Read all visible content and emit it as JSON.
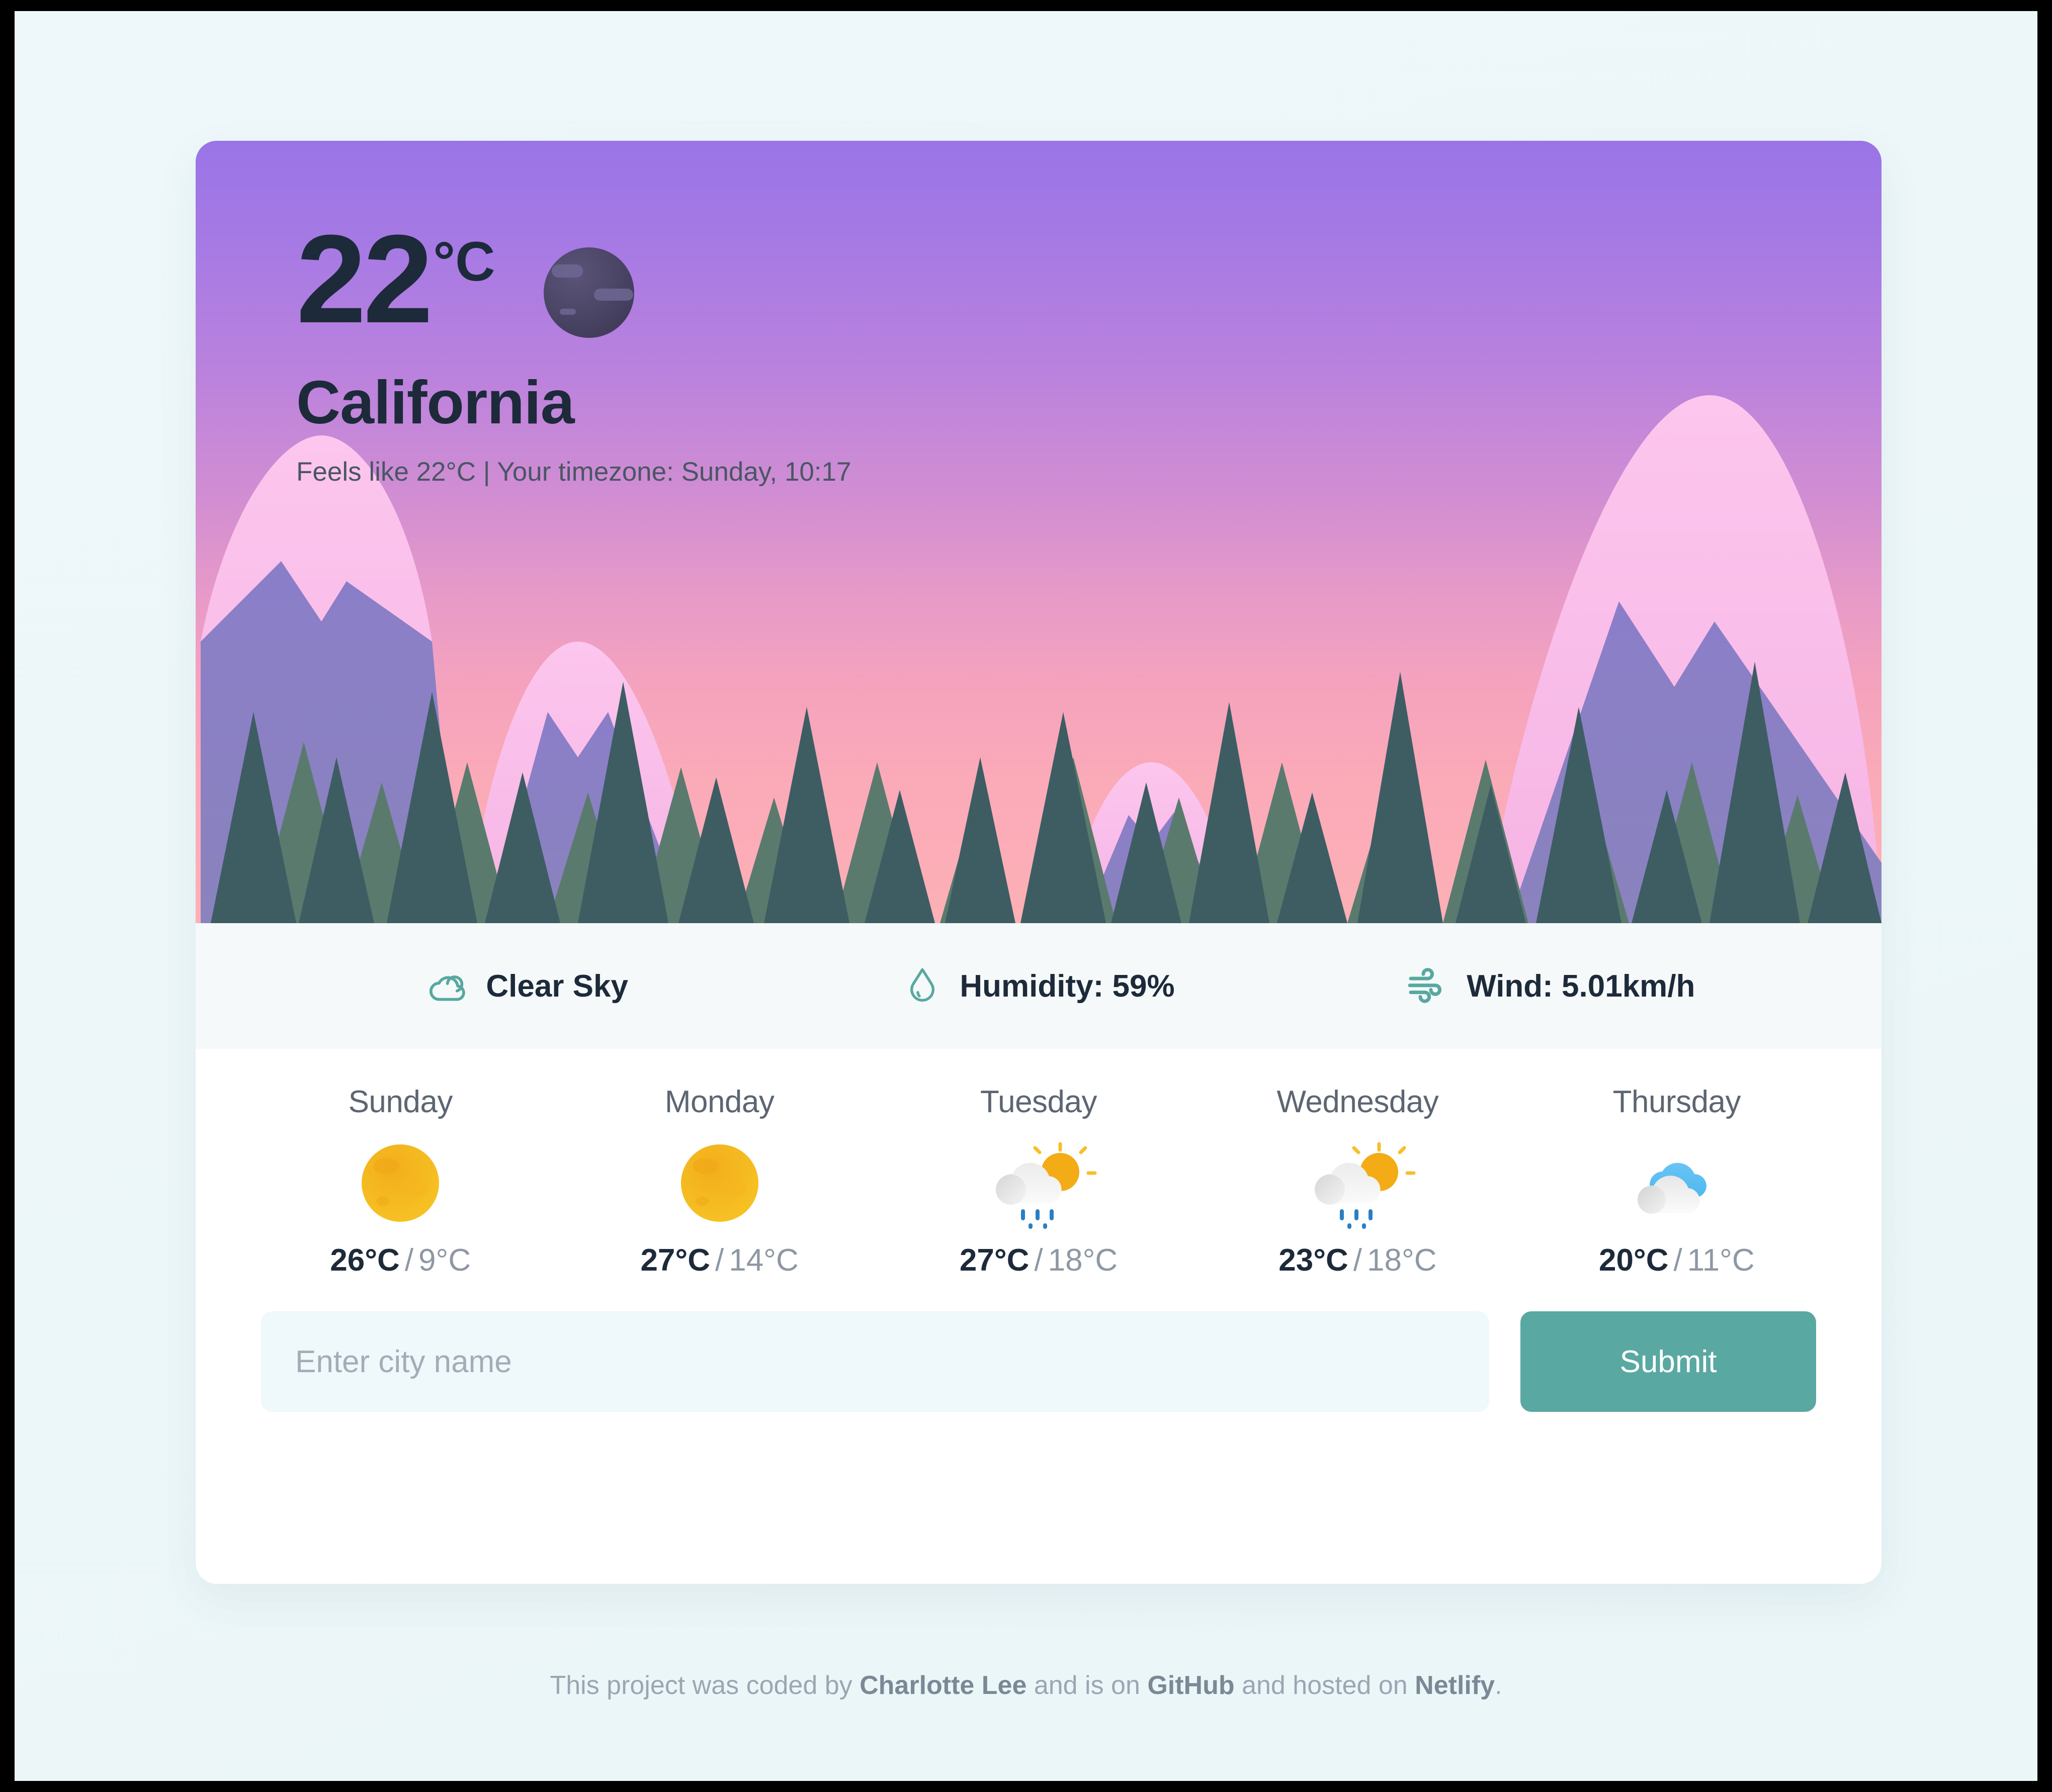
{
  "hero": {
    "temperature": "22",
    "unit": "°C",
    "icon": "moon-icon",
    "city": "California",
    "details": "Feels like 22°C | Your timezone: Sunday, 10:17"
  },
  "stats": [
    {
      "icon": "cloud-icon",
      "label": "Clear Sky"
    },
    {
      "icon": "droplet-icon",
      "label": "Humidity: 59%"
    },
    {
      "icon": "wind-icon",
      "label": "Wind: 5.01km/h"
    }
  ],
  "forecast": [
    {
      "day": "Sunday",
      "icon": "sun-icon",
      "max": "26°C",
      "sep": "/",
      "min": "9°C"
    },
    {
      "day": "Monday",
      "icon": "sun-icon",
      "max": "27°C",
      "sep": "/",
      "min": "14°C"
    },
    {
      "day": "Tuesday",
      "icon": "sun-cloud-rain-icon",
      "max": "27°C",
      "sep": "/",
      "min": "18°C"
    },
    {
      "day": "Wednesday",
      "icon": "sun-cloud-rain-icon",
      "max": "23°C",
      "sep": "/",
      "min": "18°C"
    },
    {
      "day": "Thursday",
      "icon": "clouds-icon",
      "max": "20°C",
      "sep": "/",
      "min": "11°C"
    }
  ],
  "search": {
    "placeholder": "Enter city name",
    "value": "",
    "submit_label": "Submit"
  },
  "footer": {
    "text_1": "This project was coded by ",
    "author": "Charlotte Lee",
    "text_2": " and is on ",
    "repo": "GitHub",
    "text_3": " and hosted on ",
    "host": "Netlify",
    "text_4": "."
  },
  "colors": {
    "accent_teal": "#5aa8a2",
    "hero_purple": "#9a74e6",
    "hero_pink": "#fdb0b6",
    "text_dark": "#1d2a3a",
    "text_muted": "#8e98a4",
    "page_bg": "#eef8fa",
    "stats_bg": "#f5f9fa",
    "input_bg": "#eff8fa",
    "mountain_snow": "#f9bce8",
    "mountain_body": "#8a7fc4",
    "tree_dark": "#3d5d63",
    "tree_light": "#5a7a6e",
    "moon": "#4b4566"
  }
}
